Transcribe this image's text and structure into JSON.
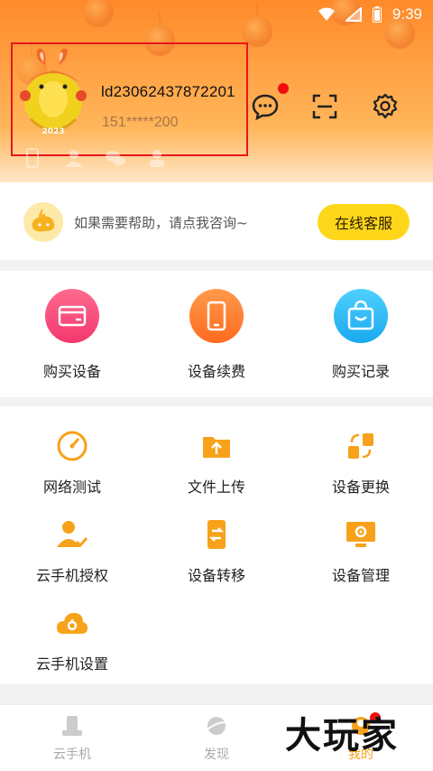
{
  "status": {
    "time": "9:39"
  },
  "profile": {
    "user_id": "ld23062437872201",
    "phone": "151*****200",
    "avatar_badge": "2023"
  },
  "help": {
    "text": "如果需要帮助，请点我咨询~",
    "button": "在线客服"
  },
  "purchase": [
    {
      "label": "购买设备",
      "icon": "card-icon",
      "color": "#f2467a"
    },
    {
      "label": "设备续费",
      "icon": "phone-icon",
      "color": "#ff7a2e"
    },
    {
      "label": "购买记录",
      "icon": "bag-icon",
      "color": "#27b7f2"
    }
  ],
  "tools": [
    {
      "label": "网络测试",
      "icon": "speedometer-icon"
    },
    {
      "label": "文件上传",
      "icon": "upload-folder-icon"
    },
    {
      "label": "设备更换",
      "icon": "swap-icon"
    },
    {
      "label": "云手机授权",
      "icon": "user-check-icon"
    },
    {
      "label": "设备转移",
      "icon": "transfer-icon"
    },
    {
      "label": "设备管理",
      "icon": "monitor-gear-icon"
    },
    {
      "label": "云手机设置",
      "icon": "cloud-gear-icon"
    }
  ],
  "nav": [
    {
      "label": "云手机",
      "icon": "cloud-phone-icon",
      "active": false
    },
    {
      "label": "发现",
      "icon": "planet-icon",
      "active": false
    },
    {
      "label": "我的",
      "icon": "me-icon",
      "active": true
    }
  ],
  "watermark": "大玩家",
  "colors": {
    "accent": "#f7a21a",
    "help_button": "#ffd71a",
    "red_dot": "#f20e0e"
  }
}
